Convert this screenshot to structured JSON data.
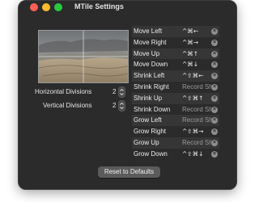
{
  "window": {
    "title": "MTile Settings"
  },
  "divisions": {
    "horizontal_label": "Horizontal Divisions",
    "horizontal_value": "2",
    "vertical_label": "Vertical Divisions",
    "vertical_value": "2"
  },
  "shortcuts": [
    {
      "name": "Move Left",
      "key": "^⌘←",
      "set": true
    },
    {
      "name": "Move Right",
      "key": "^⌘→",
      "set": true
    },
    {
      "name": "Move Up",
      "key": "^⌘↑",
      "set": true
    },
    {
      "name": "Move Down",
      "key": "^⌘↓",
      "set": true
    },
    {
      "name": "Shrink Left",
      "key": "^⇧⌘←",
      "set": true
    },
    {
      "name": "Shrink Right",
      "key": "Record Sho",
      "set": false
    },
    {
      "name": "Shrink Up",
      "key": "^⇧⌘↑",
      "set": true
    },
    {
      "name": "Shrink Down",
      "key": "Record Sho",
      "set": false
    },
    {
      "name": "Grow Left",
      "key": "Record Sho",
      "set": false
    },
    {
      "name": "Grow Right",
      "key": "^⇧⌘→",
      "set": true
    },
    {
      "name": "Grow Up",
      "key": "Record Sho",
      "set": false
    },
    {
      "name": "Grow Down",
      "key": "^⇧⌘↓",
      "set": true
    }
  ],
  "footer": {
    "reset_label": "Reset to Defaults"
  },
  "colors": {
    "window_bg": "#2b2b2b",
    "close": "#ff5f57",
    "minimize": "#febc2e",
    "maximize": "#28c840",
    "button_bg": "#5b5b5b"
  },
  "icons": {
    "clear": "clear-shortcut-icon",
    "stepper": "stepper-chevrons-icon"
  }
}
